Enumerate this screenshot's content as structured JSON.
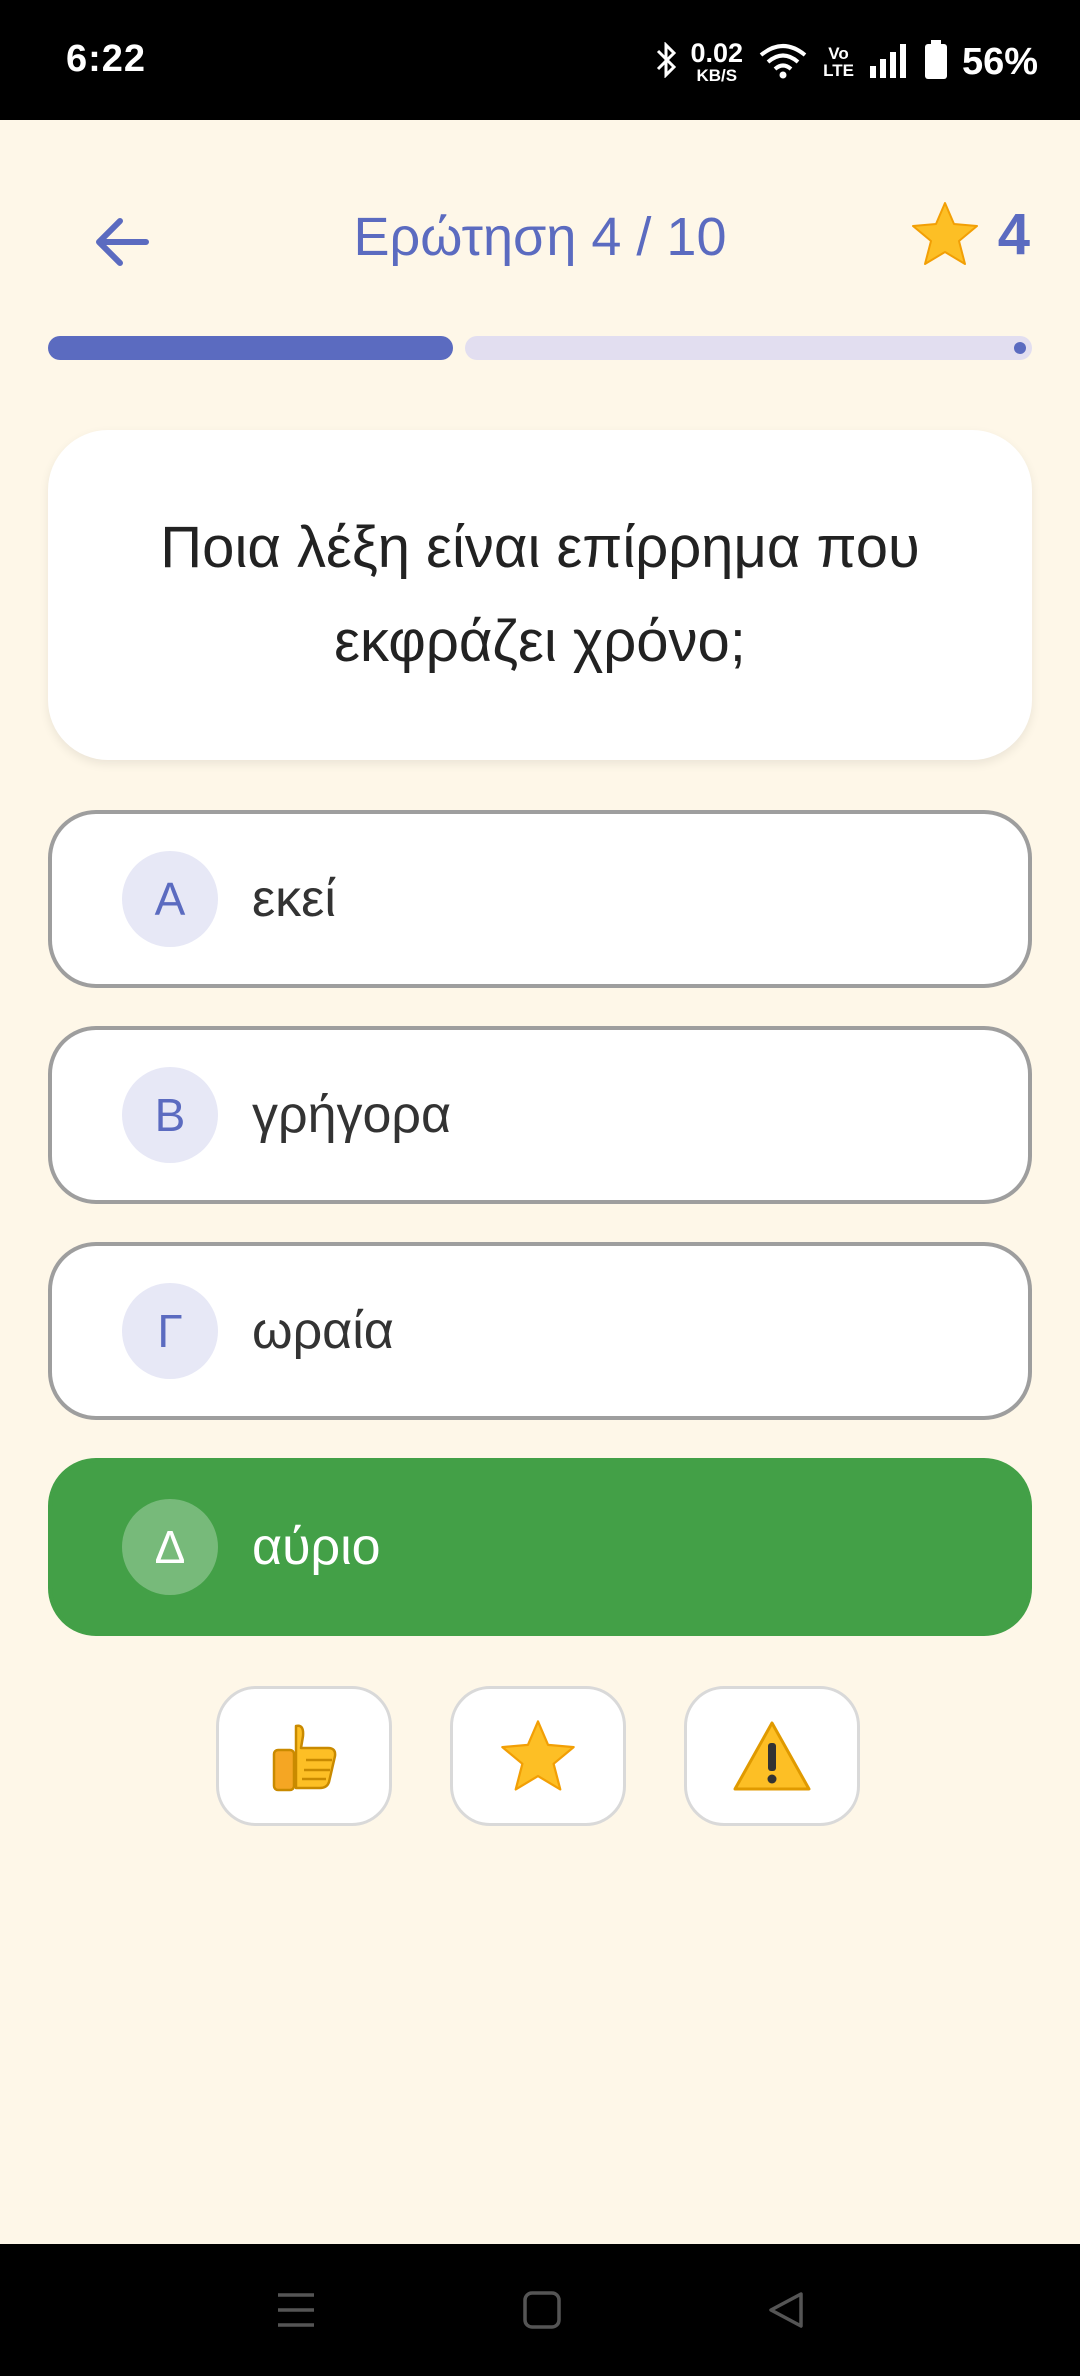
{
  "status_bar": {
    "time": "6:22",
    "net_speed_value": "0.02",
    "net_speed_unit": "KB/S",
    "volte_top": "Vo",
    "volte_bottom": "LTE",
    "battery": "56%"
  },
  "header": {
    "title": "Ερώτηση 4 / 10",
    "score": "4"
  },
  "progress": {
    "current": 4,
    "total": 10
  },
  "question": {
    "text": "Ποια λέξη είναι επίρρημα που εκφράζει χρόνο;"
  },
  "options": [
    {
      "letter": "Α",
      "text": "εκεί",
      "state": "default"
    },
    {
      "letter": "Β",
      "text": "γρήγορα",
      "state": "default"
    },
    {
      "letter": "Γ",
      "text": "ωραία",
      "state": "default"
    },
    {
      "letter": "Δ",
      "text": "αύριο",
      "state": "correct"
    }
  ],
  "actions": [
    {
      "icon": "thumbs-up-icon"
    },
    {
      "icon": "star-icon"
    },
    {
      "icon": "warning-icon"
    }
  ],
  "colors": {
    "background": "#fef7e8",
    "accent": "#5b6bc0",
    "correct": "#43a047",
    "star": "#fdbf25"
  }
}
